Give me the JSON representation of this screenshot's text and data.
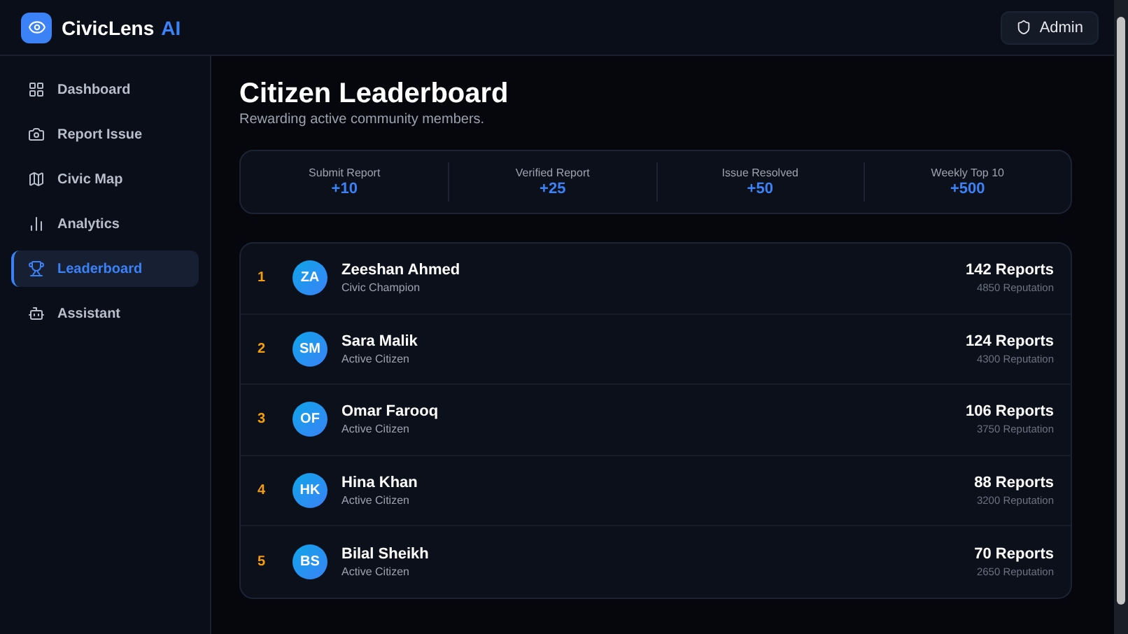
{
  "brand": {
    "name": "CivicLens",
    "suffix": "AI"
  },
  "user_button": {
    "label": "Admin"
  },
  "sidebar": {
    "items": [
      {
        "label": "Dashboard",
        "selected": false
      },
      {
        "label": "Report Issue",
        "selected": false
      },
      {
        "label": "Civic Map",
        "selected": false
      },
      {
        "label": "Analytics",
        "selected": false
      },
      {
        "label": "Leaderboard",
        "selected": true
      },
      {
        "label": "Assistant",
        "selected": false
      }
    ]
  },
  "page": {
    "title": "Citizen Leaderboard",
    "subtitle": "Rewarding active community members."
  },
  "points": [
    {
      "label": "Submit Report",
      "value": "+10"
    },
    {
      "label": "Verified Report",
      "value": "+25"
    },
    {
      "label": "Issue Resolved",
      "value": "+50"
    },
    {
      "label": "Weekly Top 10",
      "value": "+500"
    }
  ],
  "leaders": [
    {
      "rank": "1",
      "initials": "ZA",
      "name": "Zeeshan Ahmed",
      "title": "Civic Champion",
      "reports": "142 Reports",
      "reputation": "4850 Reputation"
    },
    {
      "rank": "2",
      "initials": "SM",
      "name": "Sara Malik",
      "title": "Active Citizen",
      "reports": "124 Reports",
      "reputation": "4300 Reputation"
    },
    {
      "rank": "3",
      "initials": "OF",
      "name": "Omar Farooq",
      "title": "Active Citizen",
      "reports": "106 Reports",
      "reputation": "3750 Reputation"
    },
    {
      "rank": "4",
      "initials": "HK",
      "name": "Hina Khan",
      "title": "Active Citizen",
      "reports": "88 Reports",
      "reputation": "3200 Reputation"
    },
    {
      "rank": "5",
      "initials": "BS",
      "name": "Bilal Sheikh",
      "title": "Active Citizen",
      "reports": "70 Reports",
      "reputation": "2650 Reputation"
    }
  ]
}
